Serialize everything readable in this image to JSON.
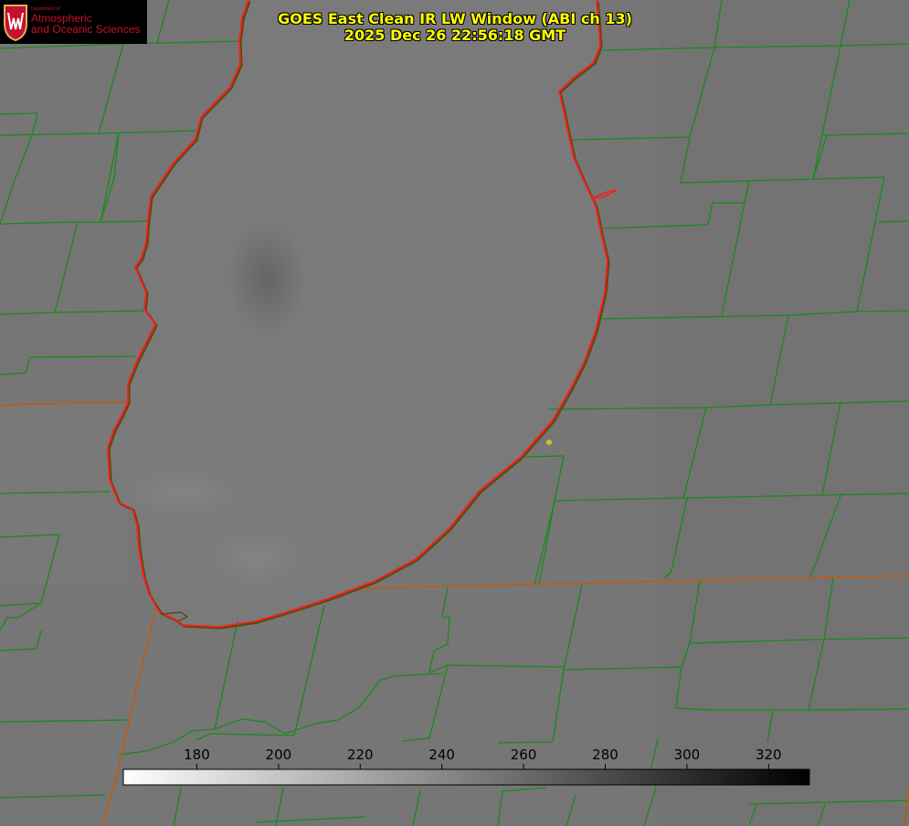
{
  "logo": {
    "department": "Department of",
    "line1": "Atmospheric",
    "line2": "and Oceanic Sciences",
    "color": "#c8102e"
  },
  "title": {
    "line1": "GOES East Clean IR LW Window (ABI ch 13)",
    "line2": "2025 Dec 26 22:56:18 GMT",
    "color": "#ffff00"
  },
  "colorbar": {
    "ticks": [
      "180",
      "200",
      "220",
      "240",
      "260",
      "280",
      "300",
      "320"
    ],
    "range": [
      162,
      330
    ],
    "gradient": [
      "#ffffff",
      "#000000"
    ]
  },
  "map": {
    "background": "#757575",
    "lake_fill": "#7a7a7a",
    "county_line_color": "#1a8a1a",
    "state_line_color": "#cc6600",
    "shoreline_color": "#ff1a1a",
    "station_color": "#d4c020"
  }
}
